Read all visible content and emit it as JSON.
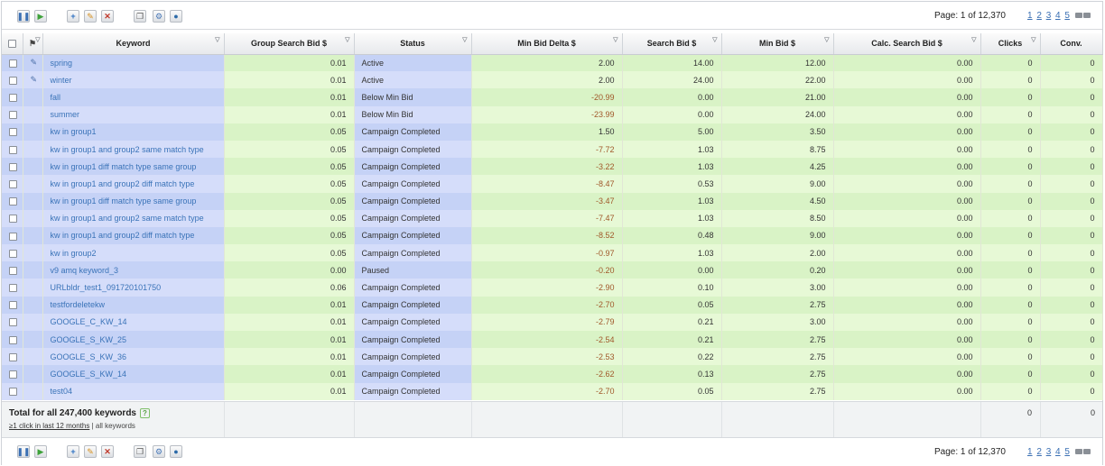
{
  "toolbar": {
    "page_info": "Page: 1 of 12,370",
    "page_links": [
      "1",
      "2",
      "3",
      "4",
      "5"
    ],
    "icons": {
      "pause": "pause-icon",
      "play": "play-icon",
      "add": "plus-icon",
      "edit": "pencil-icon",
      "delete": "x-icon",
      "copy": "copy-icon",
      "settings": "gear-icon",
      "globe": "globe-icon"
    }
  },
  "columns": {
    "keyword": "Keyword",
    "group_bid": "Group Search Bid $",
    "status": "Status",
    "min_delta": "Min Bid Delta $",
    "search_bid": "Search Bid $",
    "min_bid": "Min Bid $",
    "calc_bid": "Calc. Search Bid $",
    "clicks": "Clicks",
    "conv": "Conv."
  },
  "rows": [
    {
      "keyword": "spring",
      "group_bid": "0.01",
      "status": "Active",
      "min_delta": "2.00",
      "search_bid": "14.00",
      "min_bid": "12.00",
      "calc_bid": "0.00",
      "clicks": "0",
      "conv": "0",
      "pin": true
    },
    {
      "keyword": "winter",
      "group_bid": "0.01",
      "status": "Active",
      "min_delta": "2.00",
      "search_bid": "24.00",
      "min_bid": "22.00",
      "calc_bid": "0.00",
      "clicks": "0",
      "conv": "0",
      "pin": true
    },
    {
      "keyword": "fall",
      "group_bid": "0.01",
      "status": "Below Min Bid",
      "min_delta": "-20.99",
      "search_bid": "0.00",
      "min_bid": "21.00",
      "calc_bid": "0.00",
      "clicks": "0",
      "conv": "0",
      "pin": false
    },
    {
      "keyword": "summer",
      "group_bid": "0.01",
      "status": "Below Min Bid",
      "min_delta": "-23.99",
      "search_bid": "0.00",
      "min_bid": "24.00",
      "calc_bid": "0.00",
      "clicks": "0",
      "conv": "0",
      "pin": false
    },
    {
      "keyword": "kw in group1",
      "group_bid": "0.05",
      "status": "Campaign Completed",
      "min_delta": "1.50",
      "search_bid": "5.00",
      "min_bid": "3.50",
      "calc_bid": "0.00",
      "clicks": "0",
      "conv": "0",
      "pin": false
    },
    {
      "keyword": "kw in group1 and group2 same match type",
      "group_bid": "0.05",
      "status": "Campaign Completed",
      "min_delta": "-7.72",
      "search_bid": "1.03",
      "min_bid": "8.75",
      "calc_bid": "0.00",
      "clicks": "0",
      "conv": "0",
      "pin": false
    },
    {
      "keyword": "kw in group1 diff match type same group",
      "group_bid": "0.05",
      "status": "Campaign Completed",
      "min_delta": "-3.22",
      "search_bid": "1.03",
      "min_bid": "4.25",
      "calc_bid": "0.00",
      "clicks": "0",
      "conv": "0",
      "pin": false
    },
    {
      "keyword": "kw in group1 and group2 diff match type",
      "group_bid": "0.05",
      "status": "Campaign Completed",
      "min_delta": "-8.47",
      "search_bid": "0.53",
      "min_bid": "9.00",
      "calc_bid": "0.00",
      "clicks": "0",
      "conv": "0",
      "pin": false
    },
    {
      "keyword": "kw in group1 diff match type same group",
      "group_bid": "0.05",
      "status": "Campaign Completed",
      "min_delta": "-3.47",
      "search_bid": "1.03",
      "min_bid": "4.50",
      "calc_bid": "0.00",
      "clicks": "0",
      "conv": "0",
      "pin": false
    },
    {
      "keyword": "kw in group1 and group2 same match type",
      "group_bid": "0.05",
      "status": "Campaign Completed",
      "min_delta": "-7.47",
      "search_bid": "1.03",
      "min_bid": "8.50",
      "calc_bid": "0.00",
      "clicks": "0",
      "conv": "0",
      "pin": false
    },
    {
      "keyword": "kw in group1 and group2 diff match type",
      "group_bid": "0.05",
      "status": "Campaign Completed",
      "min_delta": "-8.52",
      "search_bid": "0.48",
      "min_bid": "9.00",
      "calc_bid": "0.00",
      "clicks": "0",
      "conv": "0",
      "pin": false
    },
    {
      "keyword": "kw in group2",
      "group_bid": "0.05",
      "status": "Campaign Completed",
      "min_delta": "-0.97",
      "search_bid": "1.03",
      "min_bid": "2.00",
      "calc_bid": "0.00",
      "clicks": "0",
      "conv": "0",
      "pin": false
    },
    {
      "keyword": "v9 amq keyword_3",
      "group_bid": "0.00",
      "status": "Paused",
      "min_delta": "-0.20",
      "search_bid": "0.00",
      "min_bid": "0.20",
      "calc_bid": "0.00",
      "clicks": "0",
      "conv": "0",
      "pin": false
    },
    {
      "keyword": "URLbldr_test1_091720101750",
      "group_bid": "0.06",
      "status": "Campaign Completed",
      "min_delta": "-2.90",
      "search_bid": "0.10",
      "min_bid": "3.00",
      "calc_bid": "0.00",
      "clicks": "0",
      "conv": "0",
      "pin": false
    },
    {
      "keyword": "testfordeletekw",
      "group_bid": "0.01",
      "status": "Campaign Completed",
      "min_delta": "-2.70",
      "search_bid": "0.05",
      "min_bid": "2.75",
      "calc_bid": "0.00",
      "clicks": "0",
      "conv": "0",
      "pin": false
    },
    {
      "keyword": "GOOGLE_C_KW_14",
      "group_bid": "0.01",
      "status": "Campaign Completed",
      "min_delta": "-2.79",
      "search_bid": "0.21",
      "min_bid": "3.00",
      "calc_bid": "0.00",
      "clicks": "0",
      "conv": "0",
      "pin": false
    },
    {
      "keyword": "GOOGLE_S_KW_25",
      "group_bid": "0.01",
      "status": "Campaign Completed",
      "min_delta": "-2.54",
      "search_bid": "0.21",
      "min_bid": "2.75",
      "calc_bid": "0.00",
      "clicks": "0",
      "conv": "0",
      "pin": false
    },
    {
      "keyword": "GOOGLE_S_KW_36",
      "group_bid": "0.01",
      "status": "Campaign Completed",
      "min_delta": "-2.53",
      "search_bid": "0.22",
      "min_bid": "2.75",
      "calc_bid": "0.00",
      "clicks": "0",
      "conv": "0",
      "pin": false
    },
    {
      "keyword": "GOOGLE_S_KW_14",
      "group_bid": "0.01",
      "status": "Campaign Completed",
      "min_delta": "-2.62",
      "search_bid": "0.13",
      "min_bid": "2.75",
      "calc_bid": "0.00",
      "clicks": "0",
      "conv": "0",
      "pin": false
    },
    {
      "keyword": "test04",
      "group_bid": "0.01",
      "status": "Campaign Completed",
      "min_delta": "-2.70",
      "search_bid": "0.05",
      "min_bid": "2.75",
      "calc_bid": "0.00",
      "clicks": "0",
      "conv": "0",
      "pin": false
    }
  ],
  "totals": {
    "title": "Total for all 247,400 keywords",
    "help": "?",
    "filter_active": "≥1 click in last 12 months",
    "filter_separator": "|",
    "filter_other": "all keywords",
    "clicks": "0",
    "conv": "0"
  },
  "colors": {
    "blue_col": "#c5d2f6",
    "green_col": "#d9f3c6",
    "link": "#3a73b8",
    "negative": "#a0582a"
  }
}
